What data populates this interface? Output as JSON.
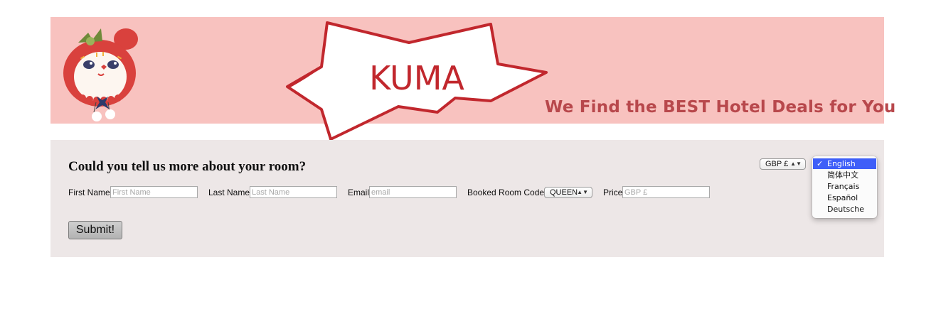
{
  "banner": {
    "logo_text": "KUMA",
    "tagline": "We Find the BEST Hotel Deals for You"
  },
  "form": {
    "heading": "Could you tell us more about your room?",
    "first_name": {
      "label": "First Name",
      "placeholder": "First Name"
    },
    "last_name": {
      "label": "Last Name",
      "placeholder": "Last Name"
    },
    "email": {
      "label": "Email",
      "placeholder": "email"
    },
    "room_code": {
      "label": "Booked Room Code",
      "selected": "QUEEN"
    },
    "price": {
      "label": "Price",
      "placeholder": "GBP £"
    },
    "submit_label": "Submit!"
  },
  "currency": {
    "selected": "GBP £"
  },
  "language_menu": {
    "items": [
      "English",
      "简体中文",
      "Français",
      "Español",
      "Deutsche"
    ],
    "selected_index": 0,
    "check_mark": "✓",
    "highlight_color": "#3f5ff8"
  },
  "colors": {
    "banner_bg": "#f8c2bf",
    "panel_bg": "#ede7e7",
    "brand_red": "#c1272d",
    "tagline": "#b8484c"
  }
}
